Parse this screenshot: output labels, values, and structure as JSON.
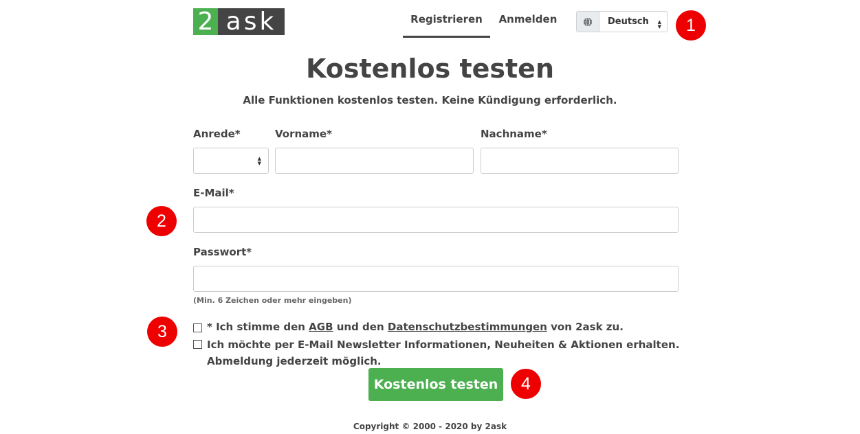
{
  "header": {
    "logo_num": "2",
    "logo_text": "ask",
    "tabs": [
      {
        "label": "Registrieren",
        "active": true
      },
      {
        "label": "Anmelden",
        "active": false
      }
    ],
    "language": {
      "selected": "Deutsch",
      "icon": "globe-icon"
    }
  },
  "badges": [
    "1",
    "2",
    "3",
    "4"
  ],
  "page": {
    "title": "Kostenlos testen",
    "subtitle": "Alle Funktionen kostenlos testen. Keine Kündigung erforderlich."
  },
  "form": {
    "salutation_label": "Anrede*",
    "salutation_value": "",
    "firstname_label": "Vorname*",
    "firstname_value": "",
    "lastname_label": "Nachname*",
    "lastname_value": "",
    "email_label": "E-Mail*",
    "email_value": "",
    "password_label": "Passwort*",
    "password_value": "",
    "password_hint": "(Min. 6 Zeichen oder mehr eingeben)",
    "terms": {
      "prefix": "* Ich stimme den ",
      "agb": "AGB",
      "middle": " und den ",
      "privacy": "Datenschutzbestimmungen",
      "suffix": " von 2ask zu."
    },
    "newsletter_line1": "Ich möchte per E-Mail Newsletter Informationen, Neuheiten & Aktionen erhalten.",
    "newsletter_line2": "Abmeldung jederzeit möglich.",
    "submit_label": "Kostenlos testen"
  },
  "footer": {
    "copyright": "Copyright © 2000 - 2020 by 2ask"
  },
  "colors": {
    "brand_green": "#4caf50",
    "dark": "#444444",
    "badge_red": "#ee0000"
  }
}
